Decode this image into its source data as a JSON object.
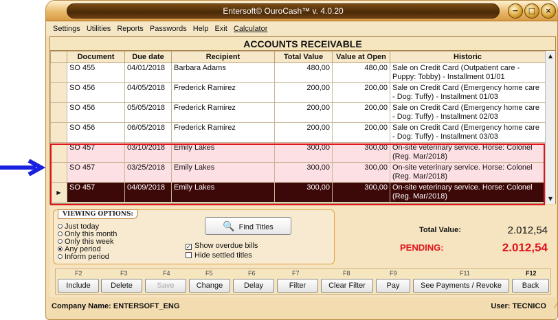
{
  "window": {
    "title": "Entersoft© OuroCash™ v. 4.0.20"
  },
  "menu": [
    "Settings",
    "Utilities",
    "Reports",
    "Passwords",
    "Help",
    "Exit",
    "Calculator"
  ],
  "heading": "ACCOUNTS RECEIVABLE",
  "table": {
    "columns": [
      "Document",
      "Due date",
      "Recipient",
      "Total Value",
      "Value at Open",
      "Historic"
    ],
    "rows": [
      {
        "doc": "SO 455",
        "due": "04/01/2018",
        "recipient": "Barbara Adams",
        "total": "480,00",
        "open": "480,00",
        "historic": "Sale on Credit Card (Outpatient care - Puppy: Tobby) - Installment 01/01"
      },
      {
        "doc": "SO 456",
        "due": "04/05/2018",
        "recipient": "Frederick Ramirez",
        "total": "200,00",
        "open": "200,00",
        "historic": "Sale on Credit Card (Emergency home care - Dog: Tuffy) - Installment 01/03"
      },
      {
        "doc": "SO 456",
        "due": "05/05/2018",
        "recipient": "Frederick Ramirez",
        "total": "200,00",
        "open": "200,00",
        "historic": "Sale on Credit Card (Emergency home care - Dog: Tuffy) - Installment 02/03"
      },
      {
        "doc": "SO 456",
        "due": "06/05/2018",
        "recipient": "Frederick Ramirez",
        "total": "200,00",
        "open": "200,00",
        "historic": "Sale on Credit Card (Emergency home care - Dog: Tuffy) - Installment 03/03"
      },
      {
        "doc": "SO 457",
        "due": "03/10/2018",
        "recipient": "Emily Lakes",
        "total": "300,00",
        "open": "300,00",
        "historic": "On-site veterinary service. Horse: Colonel (Reg. Mar/2018)"
      },
      {
        "doc": "SO 457",
        "due": "03/25/2018",
        "recipient": "Emily Lakes",
        "total": "300,00",
        "open": "300,00",
        "historic": "On-site veterinary service. Horse: Colonel (Reg. Mar/2018)"
      },
      {
        "doc": "SO 457",
        "due": "04/09/2018",
        "recipient": "Emily Lakes",
        "total": "300,00",
        "open": "300,00",
        "historic": "On-site veterinary service. Horse: Colonel (Reg. Mar/2018)"
      }
    ]
  },
  "viewing": {
    "title": "VIEWING OPTIONS:",
    "options": [
      "Just today",
      "Only this month",
      "Only this week",
      "Any period",
      "Inform period"
    ],
    "selected": "Any period"
  },
  "find_label": "Find Titles",
  "show_overdue": "Show overdue bills",
  "hide_settled": "Hide settled titles",
  "totals": {
    "total_label": "Total Value:",
    "total_value": "2.012,54",
    "pending_label": "PENDING:",
    "pending_value": "2.012,54"
  },
  "fkeys": [
    {
      "key": "F2",
      "label": "Include"
    },
    {
      "key": "F3",
      "label": "Delete"
    },
    {
      "key": "F4",
      "label": "Save"
    },
    {
      "key": "F5",
      "label": "Change"
    },
    {
      "key": "F6",
      "label": "Delay"
    },
    {
      "key": "F7",
      "label": "Filter"
    },
    {
      "key": "F8",
      "label": "Clear Filter"
    },
    {
      "key": "F9",
      "label": "Pay"
    },
    {
      "key": "F11",
      "label": "See Payments / Revoke"
    },
    {
      "key": "F12",
      "label": "Back"
    }
  ],
  "status": {
    "company": "Company Name: ENTERSOFT_ENG",
    "user": "User: TECNICO"
  },
  "colors": {
    "highlight": "#fde0e4",
    "selected": "#3d0808",
    "annotation": "#e0141c",
    "arrow": "#1a20e0"
  }
}
